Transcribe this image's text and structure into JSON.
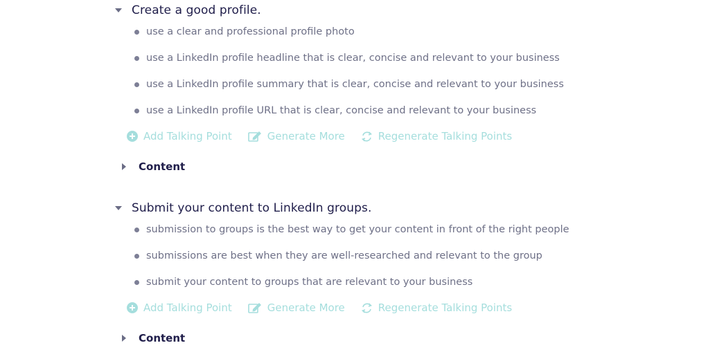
{
  "sections": [
    {
      "heading": "Create a good profile.",
      "points": [
        "use a clear and professional profile photo",
        "use a LinkedIn profile headline that is clear, concise and relevant to your business",
        "use a LinkedIn profile summary that is clear, concise and relevant to your business",
        "use a LinkedIn profile URL that is clear, concise and relevant to your business"
      ],
      "actions": {
        "add": "Add Talking Point",
        "generate": "Generate More",
        "regenerate": "Regenerate Talking Points"
      },
      "content_label": "Content"
    },
    {
      "heading": "Submit your content to LinkedIn groups.",
      "points": [
        "submission to groups is the best way to get your content in front of the right people",
        "submissions are best when they are well-researched and relevant to the group",
        "submit your content to groups that are relevant to your business"
      ],
      "actions": {
        "add": "Add Talking Point",
        "generate": "Generate More",
        "regenerate": "Regenerate Talking Points"
      },
      "content_label": "Content"
    }
  ],
  "icons": {
    "collapse": "caret-down-icon",
    "expand": "caret-right-icon",
    "add": "plus-circle-icon",
    "generate": "edit-icon",
    "regenerate": "refresh-icon"
  },
  "colors": {
    "heading": "#1f1d4a",
    "point_text": "#6e7087",
    "action": "#a5dedd"
  }
}
